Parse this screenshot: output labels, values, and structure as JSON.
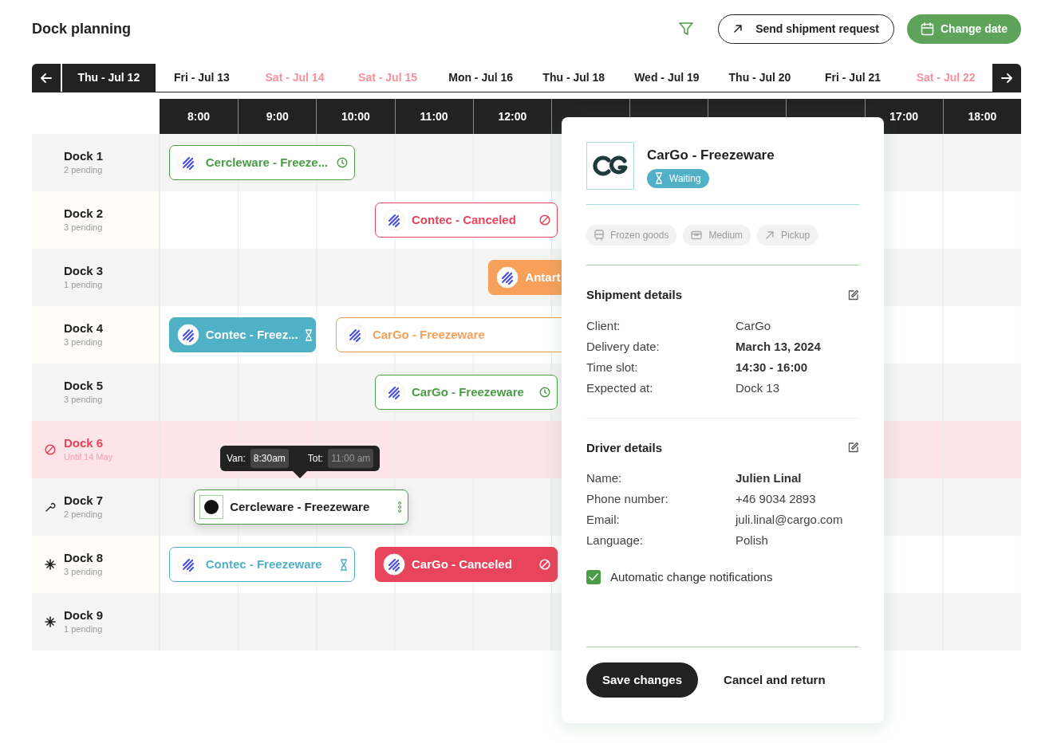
{
  "header": {
    "title": "Dock planning",
    "actions": [
      {
        "label": "Send shipment request",
        "kind": "outline"
      },
      {
        "label": "Change date",
        "kind": "primary"
      }
    ]
  },
  "dates": [
    {
      "label": "Thu - Jul 12",
      "selected": true,
      "weekend": false
    },
    {
      "label": "Fri - Jul 13",
      "selected": false,
      "weekend": false
    },
    {
      "label": "Sat - Jul 14",
      "selected": false,
      "weekend": true
    },
    {
      "label": "Sat - Jul 15",
      "selected": false,
      "weekend": true
    },
    {
      "label": "Mon - Jul 16",
      "selected": false,
      "weekend": false
    },
    {
      "label": "Thu - Jul 18",
      "selected": false,
      "weekend": false
    },
    {
      "label": "Wed - Jul 19",
      "selected": false,
      "weekend": false
    },
    {
      "label": "Thu - Jul 20",
      "selected": false,
      "weekend": false
    },
    {
      "label": "Fri - Jul 21",
      "selected": false,
      "weekend": false
    },
    {
      "label": "Sat - Jul 22",
      "selected": false,
      "weekend": true
    }
  ],
  "hours": [
    "8:00",
    "9:00",
    "10:00",
    "11:00",
    "12:00"
  ],
  "hours_end": [
    "17:00",
    "18:00"
  ],
  "docks": [
    {
      "name": "Dock 1",
      "note": "2 pending",
      "kind": "standard",
      "events": [
        {
          "label": "Cercleware - Freeze...",
          "kind": "scheduled",
          "filled": false,
          "selected": false
        }
      ]
    },
    {
      "name": "Dock 2",
      "note": "3 pending",
      "kind": "standard",
      "events": [
        {
          "label": "Contec - Canceled",
          "kind": "canceled",
          "filled": false,
          "selected": false
        }
      ]
    },
    {
      "name": "Dock 3",
      "note": "1 pending",
      "kind": "standard",
      "events": [
        {
          "label": "Antart",
          "kind": "active",
          "filled": true,
          "selected": false
        }
      ]
    },
    {
      "name": "Dock 4",
      "note": "3 pending",
      "kind": "standard",
      "events": [
        {
          "label": "Contec - Freez...",
          "kind": "waiting",
          "filled": true,
          "selected": false
        },
        {
          "label": "CarGo - Freezeware",
          "kind": "active",
          "filled": false,
          "selected": false
        }
      ]
    },
    {
      "name": "Dock 5",
      "note": "3 pending",
      "kind": "standard",
      "events": [
        {
          "label": "CarGo - Freezeware",
          "kind": "scheduled",
          "filled": false,
          "selected": false
        }
      ]
    },
    {
      "name": "Dock 6",
      "note": "Until 14 May",
      "kind": "blocked"
    },
    {
      "name": "Dock 7",
      "note": "2 pending",
      "kind": "maintenance",
      "events": [
        {
          "label": "Cercleware - Freezeware",
          "kind": "scheduled",
          "filled": false,
          "selected": true
        }
      ]
    },
    {
      "name": "Dock 8",
      "note": "3 pending",
      "kind": "frozen",
      "events": [
        {
          "label": "Contec - Freezeware",
          "kind": "waiting",
          "filled": false,
          "selected": false
        },
        {
          "label": "CarGo - Canceled",
          "kind": "canceled",
          "filled": true,
          "selected": false
        }
      ]
    },
    {
      "name": "Dock 9",
      "note": "1 pending",
      "kind": "frozen"
    }
  ],
  "tooltip": {
    "from_label": "Van:",
    "from": "8:30am",
    "to_label": "Tot:",
    "to": "11:00 am",
    "to_disabled": true
  },
  "panel": {
    "title": "CarGo - Freezeware",
    "badge": {
      "label": "Waiting",
      "kind": "waiting"
    },
    "tags": [
      {
        "label": "Frozen goods",
        "kind": "cargo"
      },
      {
        "label": "Medium",
        "kind": "size"
      },
      {
        "label": "Pickup",
        "kind": "direction"
      }
    ],
    "sections": [
      {
        "title": "Shipment details",
        "rows": [
          {
            "label": "Client:",
            "value": "CarGo",
            "bold": false
          },
          {
            "label": "Delivery date:",
            "value": "March 13, 2024",
            "bold": true
          },
          {
            "label": "Time slot:",
            "value": "14:30 - 16:00",
            "bold": true
          },
          {
            "label": "Expected at:",
            "value": "Dock 13",
            "bold": false
          }
        ]
      },
      {
        "title": "Driver details",
        "rows": [
          {
            "label": "Name:",
            "value": "Julien Linal",
            "bold": true
          },
          {
            "label": "Phone number:",
            "value": "+46 9034 2893",
            "bold": false
          },
          {
            "label": "Email:",
            "value": "juli.linal@cargo.com",
            "bold": false
          },
          {
            "label": "Language:",
            "value": "Polish",
            "bold": false
          }
        ]
      }
    ],
    "checkbox": {
      "label": "Automatic change notifications",
      "checked": true
    },
    "buttons": [
      {
        "label": "Save changes",
        "kind": "primary"
      },
      {
        "label": "Cancel and return",
        "kind": "link"
      }
    ]
  }
}
